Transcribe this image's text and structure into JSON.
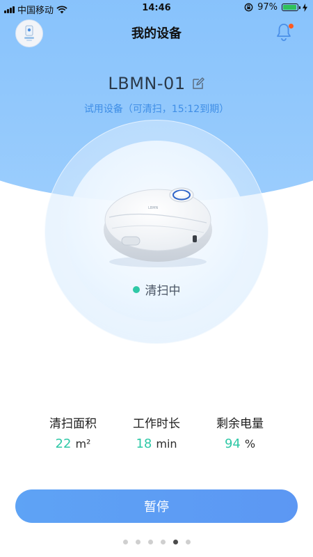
{
  "status_bar": {
    "carrier": "中国移动",
    "time": "14:46",
    "battery_text": "97%",
    "battery_level": 0.97
  },
  "header": {
    "title": "我的设备"
  },
  "device": {
    "name": "LBMN-01",
    "trial_text": "试用设备（可清扫，15:12到期）",
    "status": "清扫中",
    "status_color": "#2ec8a6"
  },
  "stats": [
    {
      "label": "清扫面积",
      "value": "22",
      "unit": "m²"
    },
    {
      "label": "工作时长",
      "value": "18",
      "unit": "min"
    },
    {
      "label": "剩余电量",
      "value": "94",
      "unit": "%"
    }
  ],
  "actions": {
    "pause_label": "暂停"
  },
  "pager": {
    "count": 6,
    "active_index": 4
  },
  "colors": {
    "accent_blue": "#5ea3f5",
    "value_green": "#2ec8a6",
    "notification_dot": "#ff5a1f"
  }
}
